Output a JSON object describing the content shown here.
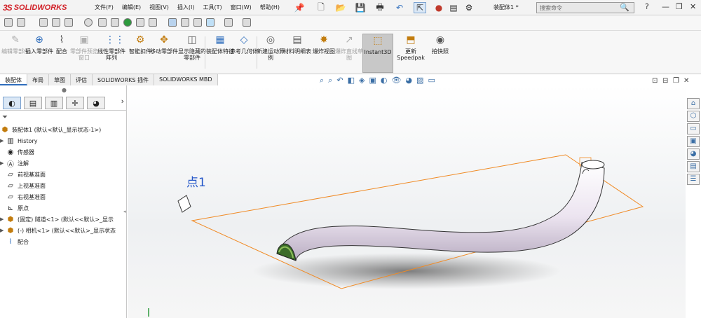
{
  "app": {
    "brand": "SOLIDWORKS",
    "brand_mark": "3S"
  },
  "menu": [
    "文件(F)",
    "编辑(E)",
    "视图(V)",
    "插入(I)",
    "工具(T)",
    "窗口(W)",
    "帮助(H)"
  ],
  "quickaccess": {
    "pin": "📌",
    "new": "🗋",
    "open": "📂",
    "save": "💾",
    "print": "🖶",
    "undo": "↶",
    "select": "⇱",
    "rebuild": "●",
    "filepage": "▤",
    "options": "⚙"
  },
  "document_title": "装配体1 *",
  "search": {
    "placeholder": "搜索命令",
    "help": "?",
    "min": "—",
    "restore": "❐",
    "close": "✕"
  },
  "ribbon": {
    "items": [
      {
        "label": "编辑零部件",
        "icon": "✎"
      },
      {
        "label": "插入零部件",
        "icon": "⊕"
      },
      {
        "label": "配合",
        "icon": "⌇"
      },
      {
        "label": "零部件预览窗口",
        "icon": "▣"
      },
      {
        "label": "线性零部件阵列",
        "icon": "⋮⋮"
      },
      {
        "label": "智能扣件",
        "icon": "⚙"
      },
      {
        "label": "移动零部件",
        "icon": "✥"
      },
      {
        "label": "显示隐藏的零部件",
        "icon": "◫"
      },
      {
        "label": "装配体特征",
        "icon": "▦"
      },
      {
        "label": "参考几何体",
        "icon": "◇"
      },
      {
        "label": "新建运动算例",
        "icon": "◎"
      },
      {
        "label": "材料明细表",
        "icon": "▤"
      },
      {
        "label": "爆炸视图",
        "icon": "✸"
      },
      {
        "label": "爆炸直线草图",
        "icon": "↗"
      },
      {
        "label": "Instant3D",
        "icon": "⬚"
      },
      {
        "label": "更新Speedpak",
        "icon": "⬒"
      },
      {
        "label": "拍快照",
        "icon": "◉"
      }
    ]
  },
  "tabs": [
    "装配体",
    "布局",
    "草图",
    "评估",
    "SOLIDWORKS 插件",
    "SOLIDWORKS MBD"
  ],
  "panel_tabs": [
    "◐",
    "▤",
    "▥",
    "✛",
    "◕"
  ],
  "tree": {
    "root": "装配体1 (默认<默认_显示状态-1>)",
    "items": [
      {
        "label": "History",
        "arrow": "▶"
      },
      {
        "label": "传感器",
        "arrow": ""
      },
      {
        "label": "注解",
        "arrow": "▶"
      },
      {
        "label": "前视基准面",
        "arrow": ""
      },
      {
        "label": "上视基准面",
        "arrow": ""
      },
      {
        "label": "右视基准面",
        "arrow": ""
      },
      {
        "label": "原点",
        "arrow": ""
      },
      {
        "label": "(固定) 隧道<1> (默认<<默认>_显示",
        "arrow": "▶"
      },
      {
        "label": "(-) 相机<1> (默认<<默认>_显示状态",
        "arrow": "▶"
      },
      {
        "label": "配合",
        "arrow": ""
      }
    ]
  },
  "viewport": {
    "point_label": "点1"
  },
  "colors": {
    "plane": "#f08a24",
    "tube": "#efe9f3",
    "tube_shadow": "#c8bfd0",
    "brand": "#d2232a"
  }
}
